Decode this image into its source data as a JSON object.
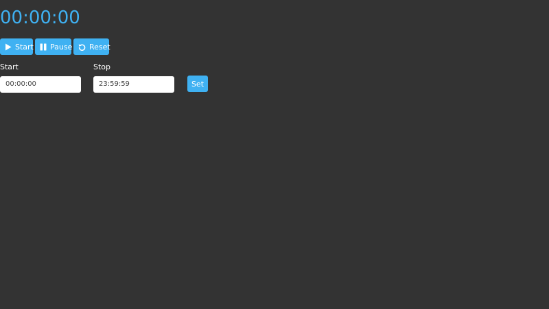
{
  "timer": {
    "display": "00:00:00"
  },
  "controls": {
    "start_label": "Start",
    "pause_label": "Pause",
    "reset_label": "Reset"
  },
  "range": {
    "start_label": "Start",
    "start_value": "00:00:00",
    "stop_label": "Stop",
    "stop_value": "23:59:59",
    "set_label": "Set"
  },
  "icons": {
    "start": "play-icon",
    "pause": "pause-icon",
    "reset": "reset-icon"
  },
  "colors": {
    "background": "#333333",
    "accent": "#3fb1f2",
    "text": "#ffffff"
  }
}
